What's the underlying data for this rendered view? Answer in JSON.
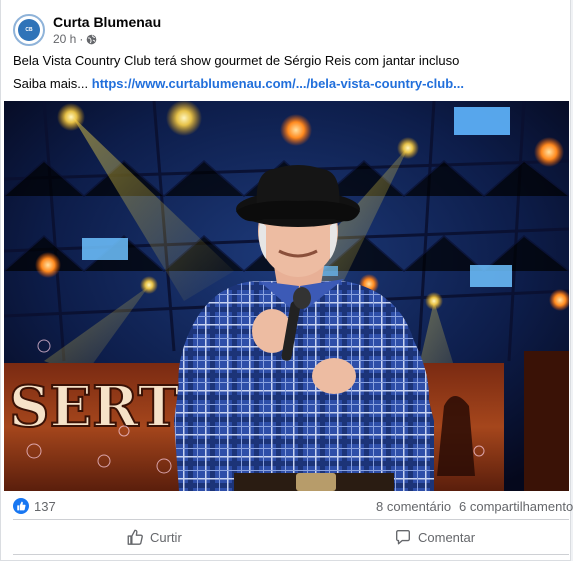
{
  "post": {
    "page_name": "Curta Blumenau",
    "avatar_text": "Curta\nBlumenau",
    "time": "20 h",
    "separator": "·",
    "line1": "Bela Vista Country Club terá show gourmet de Sérgio Reis com jantar incluso",
    "saiba": "Saiba mais... ",
    "link": "https://www.curtablumenau.com/.../bela-vista-country-club..."
  },
  "stats": {
    "likes": "137",
    "comments": "8 comentário",
    "shares": "6 compartilhamento"
  },
  "actions": {
    "like_label": "Curtir",
    "comment_label": "Comentar"
  },
  "photo": {
    "sign_text": "SERT"
  },
  "colors": {
    "link": "#216fdb",
    "like_blue": "#1877f2",
    "secondary_text": "#65676b"
  }
}
